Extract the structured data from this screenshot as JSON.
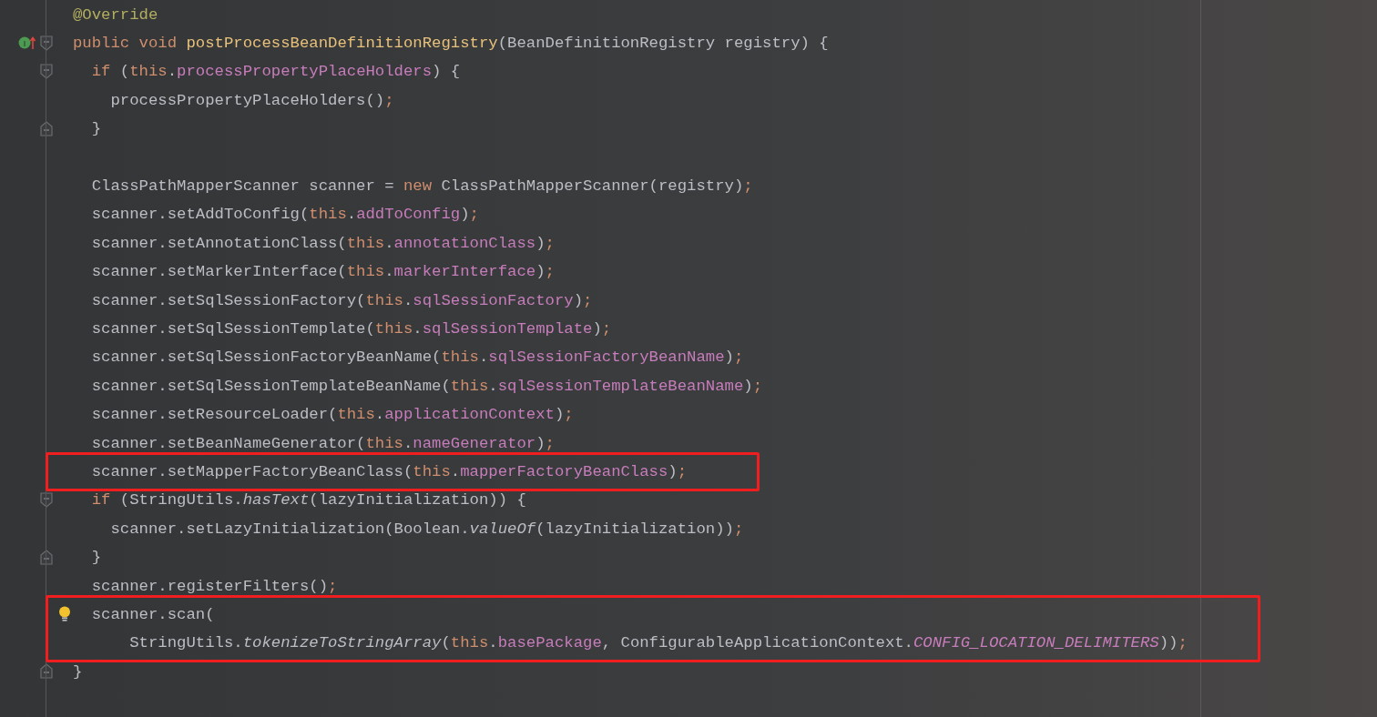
{
  "editor": {
    "lines": [
      {
        "tokens": [
          {
            "kind": "ann",
            "t": "@Override"
          }
        ]
      },
      {
        "marker": {
          "kind": "implements",
          "letter": "I"
        },
        "fold": {
          "kind": "start"
        },
        "tokens": [
          {
            "kind": "kw",
            "t": "public void "
          },
          {
            "kind": "decl",
            "t": "postProcessBeanDefinitionRegistry"
          },
          {
            "kind": "plain",
            "t": "(BeanDefinitionRegistry registry) {"
          }
        ]
      },
      {
        "fold": {
          "kind": "start"
        },
        "tokens": [
          {
            "kind": "kw",
            "t": "  if"
          },
          {
            "kind": "plain",
            "t": " ("
          },
          {
            "kind": "kw",
            "t": "this"
          },
          {
            "kind": "plain",
            "t": "."
          },
          {
            "kind": "field",
            "t": "processPropertyPlaceHolders"
          },
          {
            "kind": "plain",
            "t": ") {"
          }
        ]
      },
      {
        "tokens": [
          {
            "kind": "plain",
            "t": "    processPropertyPlaceHolders()"
          },
          {
            "kind": "semi",
            "t": ";"
          }
        ]
      },
      {
        "fold": {
          "kind": "end"
        },
        "tokens": [
          {
            "kind": "plain",
            "t": "  }"
          }
        ]
      },
      {
        "gap_before": true,
        "tokens": [
          {
            "kind": "plain",
            "t": "  ClassPathMapperScanner scanner = "
          },
          {
            "kind": "kw",
            "t": "new"
          },
          {
            "kind": "plain",
            "t": " ClassPathMapperScanner(registry)"
          },
          {
            "kind": "semi",
            "t": ";"
          }
        ]
      },
      {
        "tokens": [
          {
            "kind": "plain",
            "t": "  scanner.setAddToConfig("
          },
          {
            "kind": "kw",
            "t": "this"
          },
          {
            "kind": "plain",
            "t": "."
          },
          {
            "kind": "field",
            "t": "addToConfig"
          },
          {
            "kind": "plain",
            "t": ")"
          },
          {
            "kind": "semi",
            "t": ";"
          }
        ]
      },
      {
        "tokens": [
          {
            "kind": "plain",
            "t": "  scanner.setAnnotationClass("
          },
          {
            "kind": "kw",
            "t": "this"
          },
          {
            "kind": "plain",
            "t": "."
          },
          {
            "kind": "field",
            "t": "annotationClass"
          },
          {
            "kind": "plain",
            "t": ")"
          },
          {
            "kind": "semi",
            "t": ";"
          }
        ]
      },
      {
        "tokens": [
          {
            "kind": "plain",
            "t": "  scanner.setMarkerInterface("
          },
          {
            "kind": "kw",
            "t": "this"
          },
          {
            "kind": "plain",
            "t": "."
          },
          {
            "kind": "field",
            "t": "markerInterface"
          },
          {
            "kind": "plain",
            "t": ")"
          },
          {
            "kind": "semi",
            "t": ";"
          }
        ]
      },
      {
        "tokens": [
          {
            "kind": "plain",
            "t": "  scanner.setSqlSessionFactory("
          },
          {
            "kind": "kw",
            "t": "this"
          },
          {
            "kind": "plain",
            "t": "."
          },
          {
            "kind": "field",
            "t": "sqlSessionFactory"
          },
          {
            "kind": "plain",
            "t": ")"
          },
          {
            "kind": "semi",
            "t": ";"
          }
        ]
      },
      {
        "tokens": [
          {
            "kind": "plain",
            "t": "  scanner.setSqlSessionTemplate("
          },
          {
            "kind": "kw",
            "t": "this"
          },
          {
            "kind": "plain",
            "t": "."
          },
          {
            "kind": "field",
            "t": "sqlSessionTemplate"
          },
          {
            "kind": "plain",
            "t": ")"
          },
          {
            "kind": "semi",
            "t": ";"
          }
        ]
      },
      {
        "tokens": [
          {
            "kind": "plain",
            "t": "  scanner.setSqlSessionFactoryBeanName("
          },
          {
            "kind": "kw",
            "t": "this"
          },
          {
            "kind": "plain",
            "t": "."
          },
          {
            "kind": "field",
            "t": "sqlSessionFactoryBeanName"
          },
          {
            "kind": "plain",
            "t": ")"
          },
          {
            "kind": "semi",
            "t": ";"
          }
        ]
      },
      {
        "tokens": [
          {
            "kind": "plain",
            "t": "  scanner.setSqlSessionTemplateBeanName("
          },
          {
            "kind": "kw",
            "t": "this"
          },
          {
            "kind": "plain",
            "t": "."
          },
          {
            "kind": "field",
            "t": "sqlSessionTemplateBeanName"
          },
          {
            "kind": "plain",
            "t": ")"
          },
          {
            "kind": "semi",
            "t": ";"
          }
        ]
      },
      {
        "tokens": [
          {
            "kind": "plain",
            "t": "  scanner.setResourceLoader("
          },
          {
            "kind": "kw",
            "t": "this"
          },
          {
            "kind": "plain",
            "t": "."
          },
          {
            "kind": "field",
            "t": "applicationContext"
          },
          {
            "kind": "plain",
            "t": ")"
          },
          {
            "kind": "semi",
            "t": ";"
          }
        ]
      },
      {
        "tokens": [
          {
            "kind": "plain",
            "t": "  scanner.setBeanNameGenerator("
          },
          {
            "kind": "kw",
            "t": "this"
          },
          {
            "kind": "plain",
            "t": "."
          },
          {
            "kind": "field",
            "t": "nameGenerator"
          },
          {
            "kind": "plain",
            "t": ")"
          },
          {
            "kind": "semi",
            "t": ";"
          }
        ]
      },
      {
        "boxed": true,
        "tokens": [
          {
            "kind": "plain",
            "t": "  scanner.setMapperFactoryBeanClass("
          },
          {
            "kind": "kw",
            "t": "this"
          },
          {
            "kind": "plain",
            "t": "."
          },
          {
            "kind": "field",
            "t": "mapperFactoryBeanClass"
          },
          {
            "kind": "plain",
            "t": ")"
          },
          {
            "kind": "semi",
            "t": ";"
          }
        ]
      },
      {
        "fold": {
          "kind": "start"
        },
        "tokens": [
          {
            "kind": "kw",
            "t": "  if"
          },
          {
            "kind": "plain",
            "t": " (StringUtils."
          },
          {
            "kind": "ital",
            "t": "hasText"
          },
          {
            "kind": "plain",
            "t": "(lazyInitialization)) {"
          }
        ]
      },
      {
        "tokens": [
          {
            "kind": "plain",
            "t": "    scanner.setLazyInitialization(Boolean."
          },
          {
            "kind": "ital",
            "t": "valueOf"
          },
          {
            "kind": "plain",
            "t": "(lazyInitialization))"
          },
          {
            "kind": "semi",
            "t": ";"
          }
        ]
      },
      {
        "fold": {
          "kind": "end"
        },
        "tokens": [
          {
            "kind": "plain",
            "t": "  }"
          }
        ]
      },
      {
        "tokens": [
          {
            "kind": "plain",
            "t": "  scanner.registerFilters()"
          },
          {
            "kind": "semi",
            "t": ";"
          }
        ]
      },
      {
        "boxed": true,
        "marker": {
          "kind": "bulb"
        },
        "tokens": [
          {
            "kind": "plain",
            "t": "  scanner.scan("
          }
        ]
      },
      {
        "boxed": true,
        "tokens": [
          {
            "kind": "plain",
            "t": "      StringUtils."
          },
          {
            "kind": "ital",
            "t": "tokenizeToStringArray"
          },
          {
            "kind": "plain",
            "t": "("
          },
          {
            "kind": "kw",
            "t": "this"
          },
          {
            "kind": "plain",
            "t": "."
          },
          {
            "kind": "field",
            "t": "basePackage"
          },
          {
            "kind": "plain",
            "t": ", ConfigurableApplicationContext."
          },
          {
            "kind": "const",
            "t": "CONFIG_LOCATION_DELIMITERS"
          },
          {
            "kind": "plain",
            "t": "))"
          },
          {
            "kind": "semi",
            "t": ";"
          }
        ]
      },
      {
        "fold": {
          "kind": "end"
        },
        "tokens": [
          {
            "kind": "plain",
            "t": "}"
          }
        ]
      }
    ]
  }
}
